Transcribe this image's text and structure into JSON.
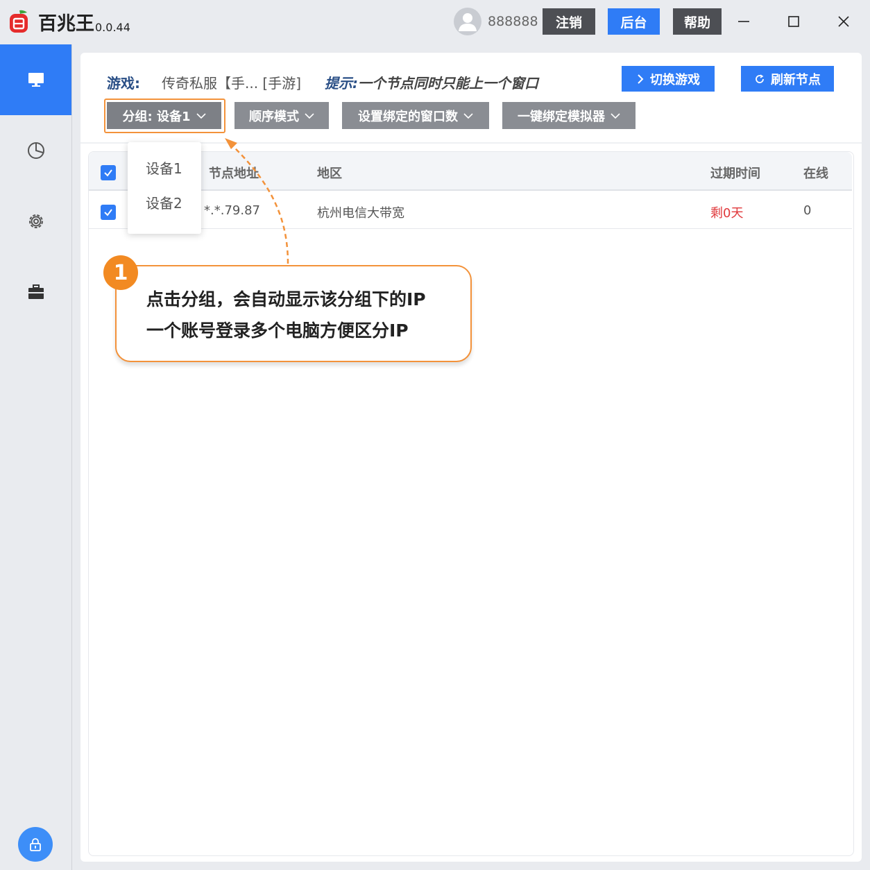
{
  "app": {
    "name": "百兆王",
    "version": "0.0.44"
  },
  "user": {
    "name": "888888"
  },
  "titlebar_buttons": {
    "logout": "注销",
    "backend": "后台",
    "help": "帮助"
  },
  "toolbar": {
    "game_label": "游戏:",
    "game_value": "传奇私服【手... [手游]",
    "hint_label": "提示:",
    "hint_text": "一个节点同时只能上一个窗口",
    "switch_game": "切换游戏",
    "refresh_nodes": "刷新节点"
  },
  "filters": {
    "group": "分组: 设备1",
    "order_mode": "顺序模式",
    "bind_windows": "设置绑定的窗口数",
    "bind_emulator": "一键绑定模拟器"
  },
  "group_dropdown": {
    "options": [
      "设备1",
      "设备2"
    ]
  },
  "table": {
    "columns": [
      "节点地址",
      "地区",
      "过期时间",
      "在线"
    ],
    "rows": [
      {
        "ip": "*.*.79.87",
        "region": "杭州电信大带宽",
        "expire": "剩0天",
        "online": "0"
      }
    ]
  },
  "callout": {
    "number": "1",
    "line1": "点击分组，会自动显示该分组下的IP",
    "line2": "一个账号登录多个电脑方便区分IP"
  },
  "sidebar": {
    "items": [
      "monitor-icon",
      "pie-chart-icon",
      "gear-icon",
      "briefcase-icon"
    ],
    "bottom": "lock-icon"
  },
  "colors": {
    "accent": "#2f7cf6",
    "gray_button": "#8a8d93",
    "highlight": "#f3923a",
    "danger": "#e0383b"
  }
}
